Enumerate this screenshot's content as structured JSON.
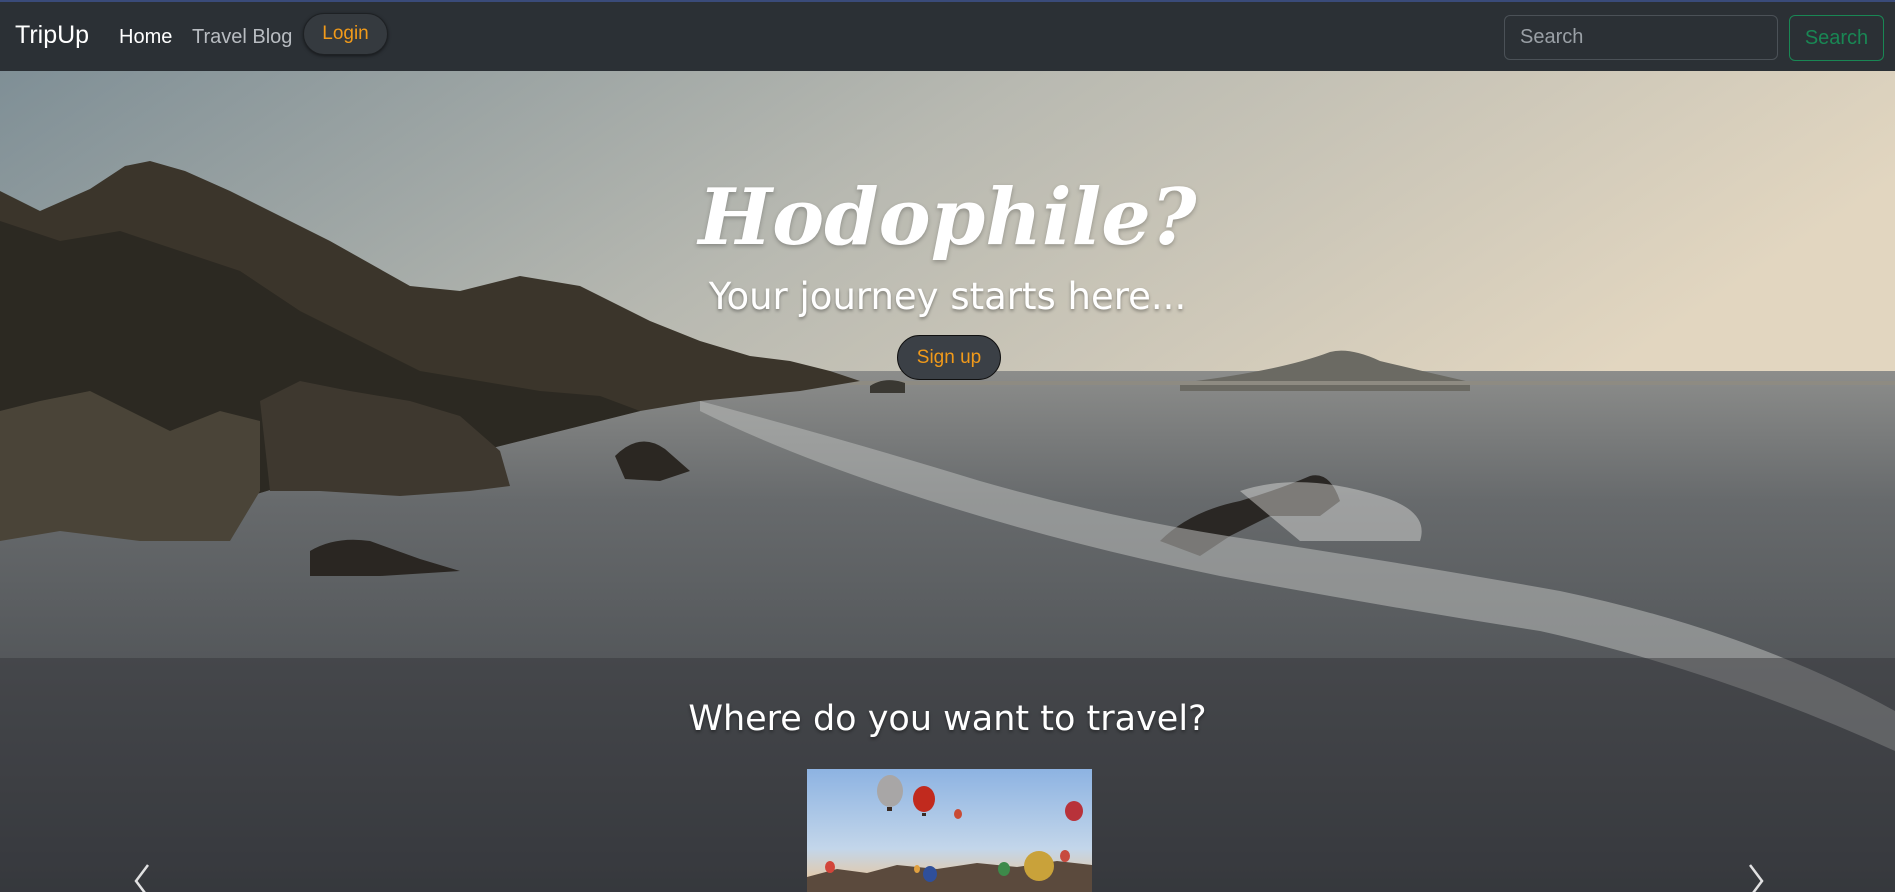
{
  "navbar": {
    "brand": "TripUp",
    "links": [
      {
        "label": "Home"
      },
      {
        "label": "Travel Blog"
      }
    ],
    "login_label": "Login",
    "search": {
      "placeholder": "Search",
      "value": "",
      "button_label": "Search"
    }
  },
  "hero": {
    "title": "Hodophile?",
    "subtitle": "Your journey starts here...",
    "signup_label": "Sign up"
  },
  "destinations": {
    "title": "Where do you want to travel?",
    "carousel": {
      "prev_icon": "chevron-left-icon",
      "next_icon": "chevron-right-icon"
    }
  },
  "colors": {
    "accent_orange": "#f19a1a",
    "success_green": "#198754",
    "navbar_bg": "#2b3035"
  }
}
